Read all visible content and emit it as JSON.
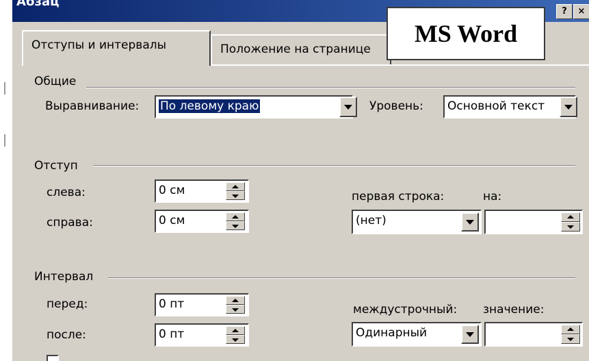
{
  "dialog": {
    "title": "Абзац",
    "title_buttons": [
      "?",
      "×"
    ]
  },
  "annotation": {
    "text": "MS Word"
  },
  "tabs": [
    {
      "label": "Отступы и интервалы",
      "active": true
    },
    {
      "label": "Положение на странице",
      "active": false
    }
  ],
  "general": {
    "header": "Общие",
    "alignment_label": "Выравнивание:",
    "alignment_value": "По левому краю",
    "level_label": "Уровень:",
    "level_value": "Основной текст"
  },
  "indent": {
    "header": "Отступ",
    "left_label": "слева:",
    "left_value": "0 см",
    "right_label": "справа:",
    "right_value": "0 см",
    "first_line_label": "первая строка:",
    "first_line_value": "(нет)",
    "by_label": "на:",
    "by_value": ""
  },
  "spacing": {
    "header": "Интервал",
    "before_label": "перед:",
    "before_value": "0 пт",
    "after_label": "после:",
    "after_value": "0 пт",
    "line_spacing_label": "междустрочный:",
    "line_spacing_value": "Одинарный",
    "at_label": "значение:",
    "at_value": ""
  },
  "colors": {
    "dialog_bg": "#d4d0c8",
    "titlebar": "#0a246a",
    "selection": "#0a246a"
  }
}
